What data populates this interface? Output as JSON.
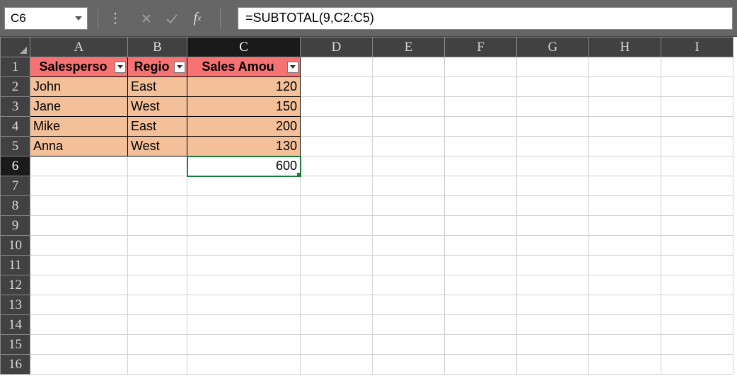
{
  "name_box": "C6",
  "formula_bar": "=SUBTOTAL(9,C2:C5)",
  "columns": [
    "A",
    "B",
    "C",
    "D",
    "E",
    "F",
    "G",
    "H",
    "I"
  ],
  "row_count": 16,
  "active_col_idx": 2,
  "active_row": 6,
  "selected_cell": "C6",
  "table": {
    "headers": [
      "Salesperson",
      "Region",
      "Sales Amount"
    ],
    "header_display": [
      "Salesperso",
      "Regio",
      "Sales Amou"
    ],
    "rows": [
      {
        "person": "John",
        "region": "East",
        "amount": 120
      },
      {
        "person": "Jane",
        "region": "West",
        "amount": 150
      },
      {
        "person": "Mike",
        "region": "East",
        "amount": 200
      },
      {
        "person": "Anna",
        "region": "West",
        "amount": 130
      }
    ],
    "subtotal": 600
  },
  "chart_data": {
    "type": "table",
    "title": "",
    "columns": [
      "Salesperson",
      "Region",
      "Sales Amount"
    ],
    "rows": [
      [
        "John",
        "East",
        120
      ],
      [
        "Jane",
        "West",
        150
      ],
      [
        "Mike",
        "East",
        200
      ],
      [
        "Anna",
        "West",
        130
      ]
    ],
    "subtotal": 600
  },
  "colors": {
    "header_bg": "#f77373",
    "data_bg": "#f3c09a",
    "selection": "#1a7a3a"
  }
}
